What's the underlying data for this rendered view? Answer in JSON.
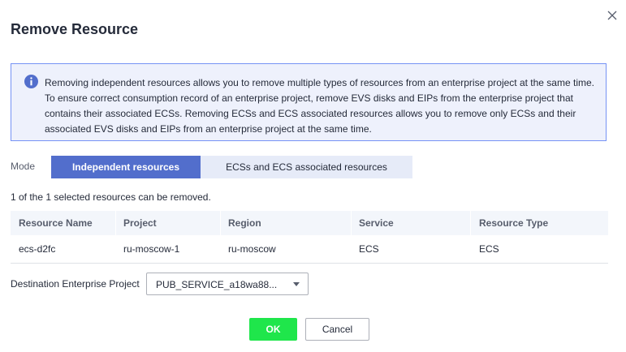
{
  "dialog": {
    "title": "Remove Resource",
    "close_icon": "close-icon"
  },
  "info": {
    "icon": "info-icon",
    "icon_color": "#526ecc",
    "text": "Removing independent resources allows you to remove multiple types of resources from an enterprise project at the same time. To ensure correct consumption record of an enterprise project, remove EVS disks and EIPs from the enterprise project that contains their associated ECSs. Removing ECSs and ECS associated resources allows you to remove only ECSs and their associated EVS disks and EIPs from an enterprise project at the same time."
  },
  "mode": {
    "label": "Mode",
    "options": [
      "Independent resources",
      "ECSs and ECS associated resources"
    ],
    "selected": "Independent resources"
  },
  "summary": "1 of the 1 selected resources can be removed.",
  "table": {
    "columns": [
      "Resource Name",
      "Project",
      "Region",
      "Service",
      "Resource Type"
    ],
    "rows": [
      [
        "ecs-d2fc",
        "ru-moscow-1",
        "ru-moscow",
        "ECS",
        "ECS"
      ]
    ]
  },
  "destination": {
    "label": "Destination Enterprise Project",
    "value": "PUB_SERVICE_a18wa88...",
    "caret_icon": "caret-down-icon"
  },
  "buttons": {
    "ok": "OK",
    "cancel": "Cancel",
    "ok_color": "#1fe64b"
  }
}
